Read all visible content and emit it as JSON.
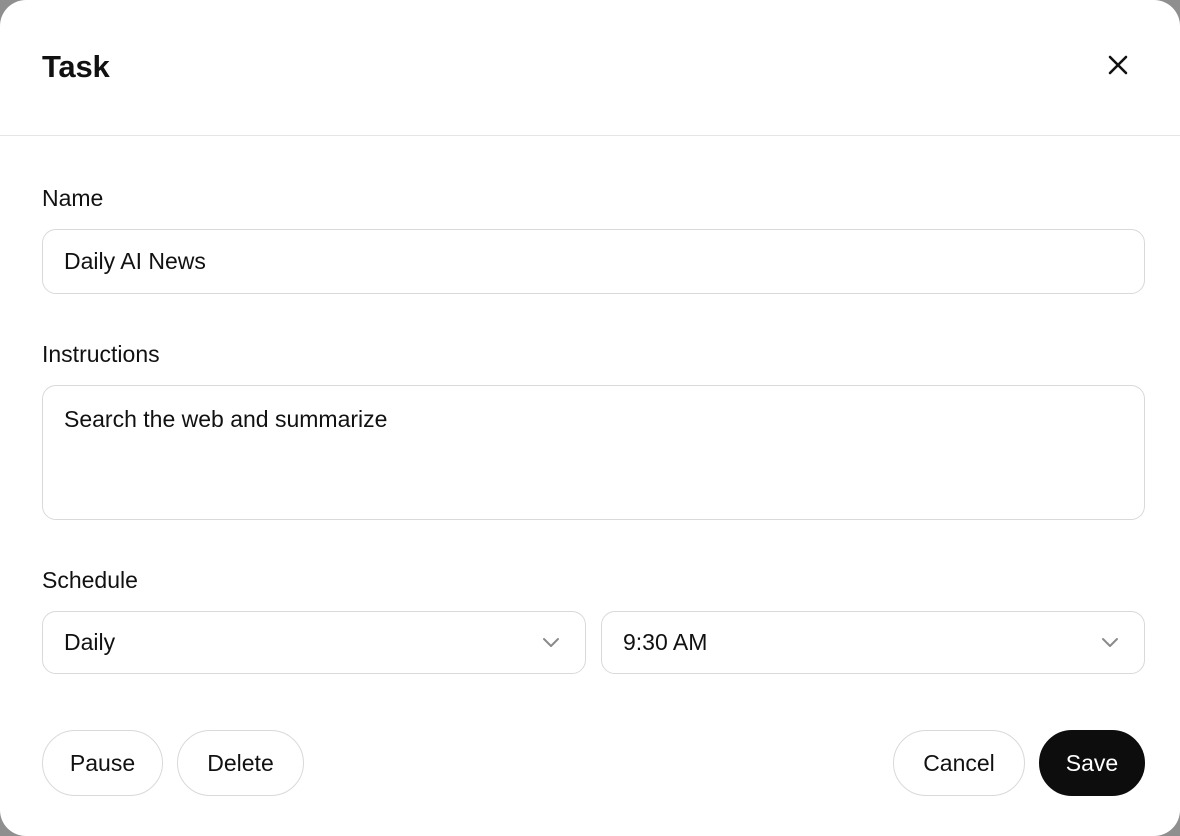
{
  "dialog": {
    "title": "Task",
    "close_icon": "close-icon"
  },
  "form": {
    "name": {
      "label": "Name",
      "value": "Daily AI News"
    },
    "instructions": {
      "label": "Instructions",
      "value": "Search the web and summarize"
    },
    "schedule": {
      "label": "Schedule",
      "frequency": {
        "value": "Daily",
        "icon": "chevron-down-icon"
      },
      "time": {
        "value": "9:30 AM",
        "icon": "chevron-down-icon"
      }
    }
  },
  "actions": {
    "pause_label": "Pause",
    "delete_label": "Delete",
    "cancel_label": "Cancel",
    "save_label": "Save"
  },
  "colors": {
    "primary_button": "#0d0d0d",
    "border": "#d9d9d9",
    "text": "#111111"
  }
}
